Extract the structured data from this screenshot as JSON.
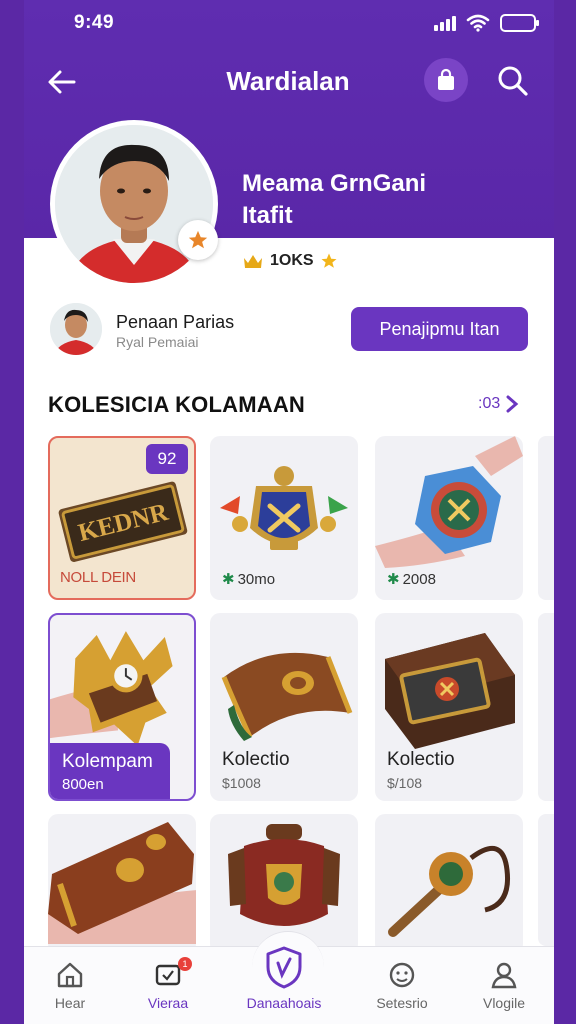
{
  "status": {
    "time": "9:49"
  },
  "nav": {
    "title": "Wardialan"
  },
  "profile": {
    "name": "Meama GrnGani",
    "subtitle": "Itafit",
    "coins": "1OKS"
  },
  "seller": {
    "name": "Penaan Parias",
    "subtitle": "Ryal Pemaiai",
    "cta_label": "Penajipmu Itan"
  },
  "section": {
    "title": "KOLESICIA KOLAMAAN",
    "see_all": ":03"
  },
  "items": [
    {
      "qty": "92",
      "label": "NOLL DEIN"
    },
    {
      "price": "30mo"
    },
    {
      "price": "2008"
    },
    {
      "tag_title": "Kolempam",
      "tag_price": "800en"
    },
    {
      "label": "Kolectio",
      "price": "$1008"
    },
    {
      "label": "Kolectio",
      "price": "$/108"
    }
  ],
  "tabs": [
    {
      "label": "Hear"
    },
    {
      "label": "Vieraa",
      "badge": "1"
    },
    {
      "label": "Danaahoais"
    },
    {
      "label": "Setesrio"
    },
    {
      "label": "Vlogile"
    }
  ],
  "colors": {
    "primary": "#6a36c0",
    "hero": "#5a27a8",
    "accent_red": "#e46b5c"
  }
}
